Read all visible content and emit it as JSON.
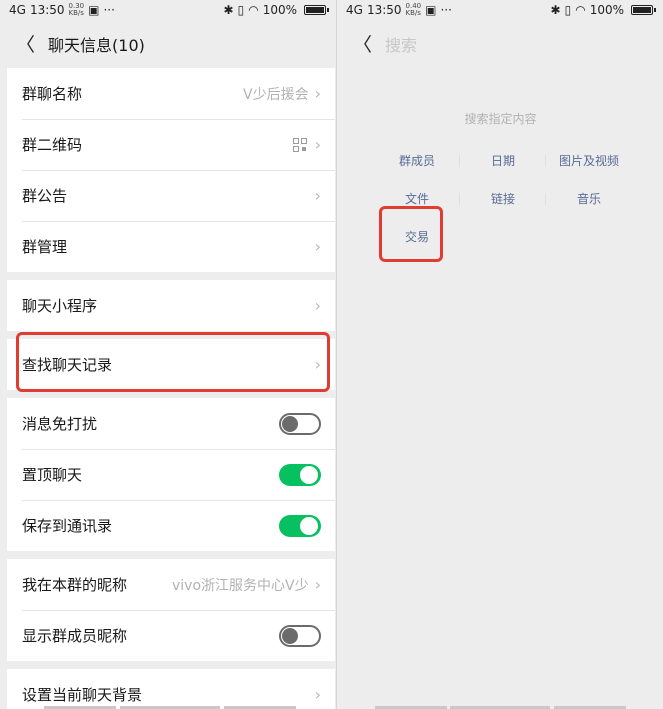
{
  "status_bar": {
    "signal": "4G",
    "time": "13:50",
    "left_speed": "0.30\nKB/s",
    "right_speed": "0.40\nKB/s",
    "more": "···",
    "battery": "100%"
  },
  "left": {
    "title": "聊天信息(10)",
    "groups": [
      {
        "rows": [
          {
            "label": "群聊名称",
            "value": "V少后援会",
            "type": "chevron"
          },
          {
            "label": "群二维码",
            "value": "",
            "type": "qr"
          },
          {
            "label": "群公告",
            "value": "",
            "type": "chevron"
          },
          {
            "label": "群管理",
            "value": "",
            "type": "chevron"
          }
        ]
      },
      {
        "rows": [
          {
            "label": "聊天小程序",
            "value": "",
            "type": "chevron"
          }
        ]
      },
      {
        "rows": [
          {
            "label": "查找聊天记录",
            "value": "",
            "type": "chevron"
          }
        ]
      },
      {
        "rows": [
          {
            "label": "消息免打扰",
            "type": "toggle",
            "on": false
          },
          {
            "label": "置顶聊天",
            "type": "toggle",
            "on": true
          },
          {
            "label": "保存到通讯录",
            "type": "toggle",
            "on": true
          }
        ]
      },
      {
        "rows": [
          {
            "label": "我在本群的昵称",
            "value": "vivo浙江服务中心V少",
            "type": "chevron"
          },
          {
            "label": "显示群成员昵称",
            "type": "toggle",
            "on": false
          }
        ]
      },
      {
        "rows": [
          {
            "label": "设置当前聊天背景",
            "value": "",
            "type": "chevron"
          }
        ]
      }
    ]
  },
  "right": {
    "search_placeholder": "搜索",
    "hint": "搜索指定内容",
    "categories": [
      "群成员",
      "日期",
      "图片及视频",
      "文件",
      "链接",
      "音乐",
      "交易"
    ]
  },
  "colors": {
    "accent_green": "#07c160",
    "link_blue": "#576b95",
    "highlight_red": "#e03c31"
  }
}
